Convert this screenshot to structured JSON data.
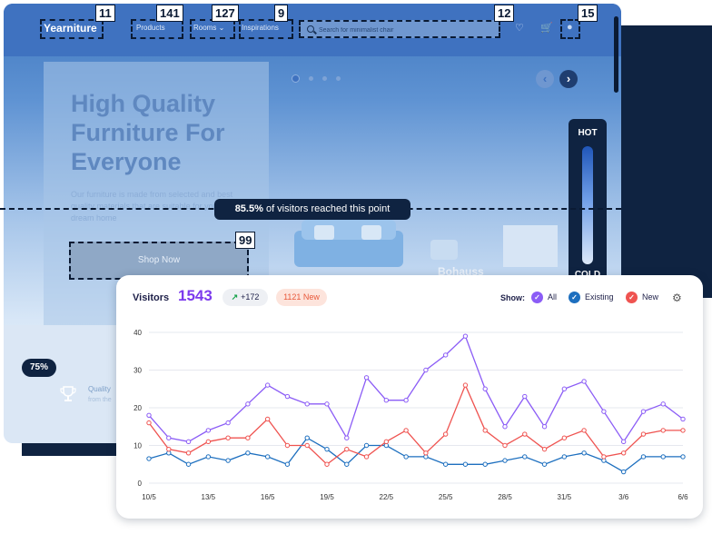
{
  "site": {
    "logo": "Yearniture",
    "nav": [
      "Products",
      "Rooms",
      "Inspirations"
    ],
    "search_placeholder": "Search for minimalist chair",
    "hero_title": "High Quality Furniture For Everyone",
    "hero_desc": "Our furniture is made from selected and best quality materials that are suitable for your dream home",
    "cta": "Shop Now",
    "watermark": "Bohauss",
    "badge_pct": "75%",
    "feature_title": "Quality",
    "feature_sub": "from the",
    "heatmap": {
      "hot": "HOT",
      "cold": "COLD"
    },
    "reach": {
      "pct": "85.5%",
      "text": " of visitors reached this point"
    },
    "tags": {
      "logo": "11",
      "products": "141",
      "rooms": "127",
      "inspirations": "9",
      "search": "12",
      "icon": "15",
      "cta": "99"
    }
  },
  "visitors": {
    "label": "Visitors",
    "count": "1543",
    "delta": "+172",
    "new": "1121 New",
    "show_label": "Show:",
    "legend": [
      {
        "name": "All",
        "color": "#8b5cf6"
      },
      {
        "name": "Existing",
        "color": "#1d6fbf"
      },
      {
        "name": "New",
        "color": "#ef5350"
      }
    ]
  },
  "chart_data": {
    "type": "line",
    "title": "",
    "ylim": [
      0,
      40
    ],
    "yticks": [
      0,
      10,
      20,
      30,
      40
    ],
    "x": [
      "10/5",
      "11/5",
      "12/5",
      "13/5",
      "14/5",
      "15/5",
      "16/5",
      "17/5",
      "18/5",
      "19/5",
      "20/5",
      "21/5",
      "22/5",
      "23/5",
      "24/5",
      "25/5",
      "26/5",
      "27/5",
      "28/5",
      "29/5",
      "30/5",
      "31/5",
      "1/6",
      "2/6",
      "3/6",
      "4/6",
      "5/6",
      "6/6"
    ],
    "xticks": [
      "10/5",
      "13/5",
      "16/5",
      "19/5",
      "22/5",
      "25/5",
      "28/5",
      "31/5",
      "3/6",
      "6/6"
    ],
    "series": [
      {
        "name": "All",
        "color": "#8b5cf6",
        "values": [
          18,
          12,
          11,
          14,
          16,
          21,
          26,
          23,
          21,
          21,
          12,
          28,
          22,
          22,
          30,
          34,
          39,
          25,
          15,
          23,
          15,
          25,
          27,
          19,
          11,
          19,
          21,
          17
        ]
      },
      {
        "name": "Existing",
        "color": "#1d6fbf",
        "values": [
          6.5,
          8,
          5,
          7,
          6,
          8,
          7,
          5,
          12,
          9,
          5,
          10,
          10,
          7,
          7,
          5,
          5,
          5,
          6,
          7,
          5,
          7,
          8,
          6,
          3,
          7,
          7,
          7
        ]
      },
      {
        "name": "New",
        "color": "#ef5350",
        "values": [
          16,
          9,
          8,
          11,
          12,
          12,
          17,
          10,
          10,
          5,
          9,
          7,
          11,
          14,
          8,
          13,
          26,
          14,
          10,
          13,
          9,
          12,
          14,
          7,
          8,
          13,
          14,
          14
        ]
      }
    ]
  }
}
